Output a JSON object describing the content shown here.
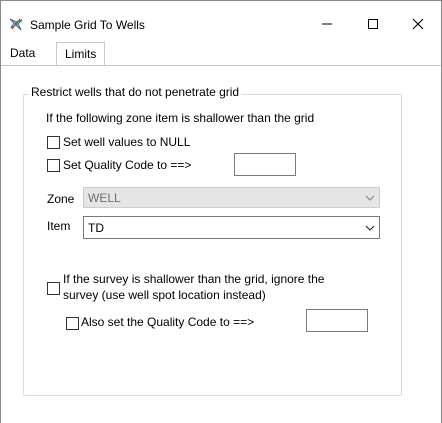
{
  "window": {
    "title": "Sample Grid To Wells",
    "controls": {
      "minimize": "—",
      "maximize": "☐",
      "close": "✕"
    }
  },
  "tabs": [
    {
      "label": "Data",
      "selected": false
    },
    {
      "label": "Limits",
      "selected": true
    }
  ],
  "limits": {
    "group_title": "Restrict wells that do not penetrate grid",
    "zone_item_text": "If the following zone item is shallower than the grid",
    "null_checkbox": {
      "label": "Set well values to NULL",
      "checked": false
    },
    "quality_checkbox": {
      "label": "Set Quality Code to  ==>",
      "checked": false,
      "value": ""
    },
    "zone": {
      "label": "Zone",
      "value": "WELL",
      "enabled": false
    },
    "item": {
      "label": "Item",
      "value": "TD",
      "enabled": true
    },
    "survey_checkbox": {
      "label_line1": "If the survey is shallower than the grid, ignore the",
      "label_line2": "survey (use well spot location instead)",
      "checked": false
    },
    "also_quality_checkbox": {
      "label": "Also set the Quality Code to  ==>",
      "checked": false,
      "value": ""
    }
  },
  "icons": {
    "app": "grid-wells-icon",
    "dropdown": "chevron-down-icon"
  }
}
